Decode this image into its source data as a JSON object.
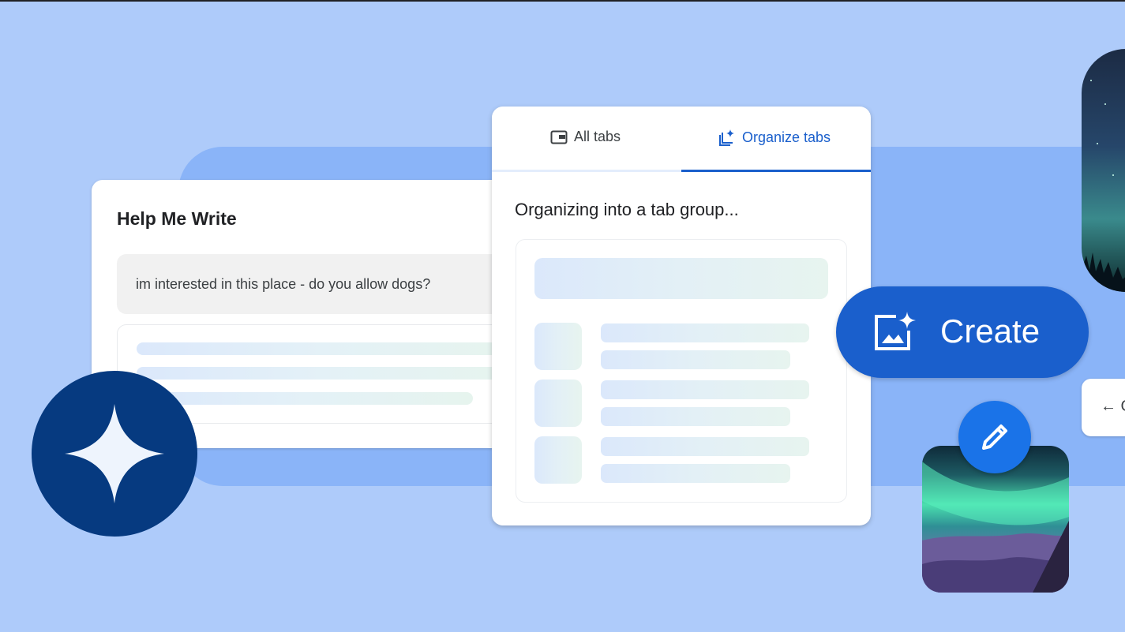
{
  "help_me_write": {
    "title": "Help Me Write",
    "prompt": "im interested in this place - do you allow dogs?"
  },
  "tab_organizer": {
    "tabs": [
      {
        "label": "All tabs",
        "icon": "tab-window-icon",
        "selected": false
      },
      {
        "label": "Organize tabs",
        "icon": "organize-tabs-sparkle-icon",
        "selected": true
      }
    ],
    "status": "Organizing into a tab group..."
  },
  "create_button": {
    "label": "Create",
    "icon": "image-sparkle-icon"
  },
  "edge_card": {
    "icon": "arrow-left-icon",
    "text": "← G"
  },
  "icons": {
    "spark": "gemini-spark-icon",
    "pencil": "pencil-icon"
  },
  "colors": {
    "background": "#aecbfa",
    "band": "#8ab4f8",
    "accent": "#1a5fcc",
    "spark_circle": "#063a80"
  }
}
